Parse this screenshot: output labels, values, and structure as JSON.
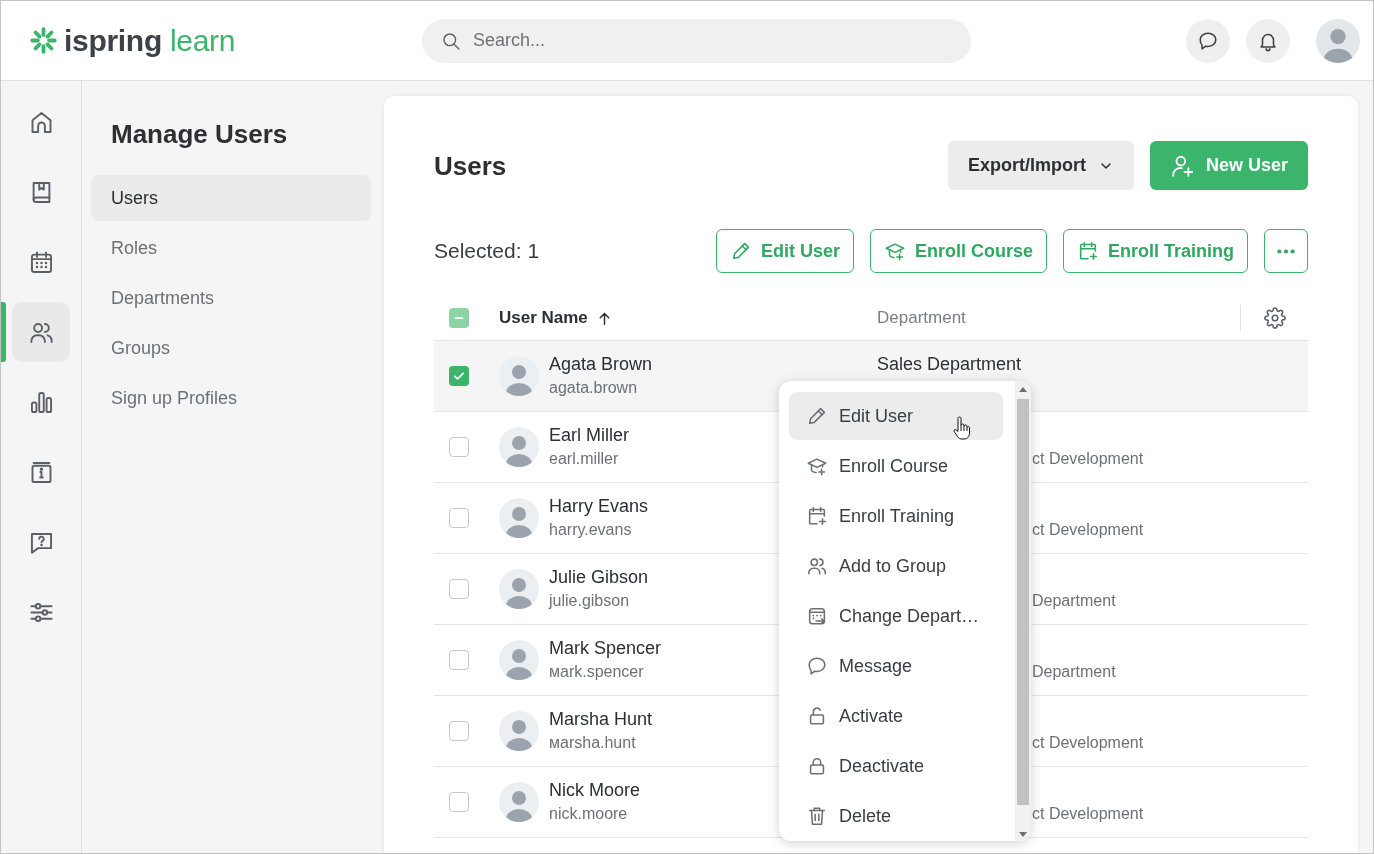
{
  "header": {
    "logo": {
      "brand": "ispring",
      "product": "learn"
    },
    "search": {
      "placeholder": "Search..."
    }
  },
  "rail": {
    "items": [
      {
        "selected": false
      },
      {
        "selected": false
      },
      {
        "selected": false
      },
      {
        "selected": true
      },
      {
        "selected": false
      },
      {
        "selected": false
      },
      {
        "selected": false
      },
      {
        "selected": false
      }
    ]
  },
  "sidebar": {
    "title": "Manage Users",
    "items": [
      {
        "label": "Users",
        "selected": true
      },
      {
        "label": "Roles",
        "selected": false
      },
      {
        "label": "Departments",
        "selected": false
      },
      {
        "label": "Groups",
        "selected": false
      },
      {
        "label": "Sign up Profiles",
        "selected": false
      }
    ]
  },
  "page": {
    "title": "Users",
    "actions": [
      {
        "kind": "dropdown",
        "label": "Export/Import"
      },
      {
        "kind": "primary",
        "label": "New User"
      }
    ]
  },
  "selection": {
    "label": "Selected: 1",
    "actions": [
      {
        "kind": "outline",
        "label": "Edit User"
      },
      {
        "kind": "outline",
        "label": "Enroll Course"
      },
      {
        "kind": "outline",
        "label": "Enroll Training"
      },
      {
        "kind": "more"
      }
    ]
  },
  "table": {
    "select_all": {
      "indeterminate": true
    },
    "columns": [
      {
        "label": "User Name",
        "sorted": true
      },
      {
        "label": "Department",
        "sorted": false
      }
    ],
    "rows": [
      {
        "checked": true,
        "name": "Agata Brown",
        "login": "agata.brown",
        "department": "Sales Department"
      },
      {
        "checked": false,
        "name": "Earl Miller",
        "login": "earl.miller",
        "department_line_2": "ct Development"
      },
      {
        "checked": false,
        "name": "Harry Evans",
        "login": "harry.evans",
        "department_line_2": "ct Development"
      },
      {
        "checked": false,
        "name": "Julie Gibson",
        "login": "julie.gibson",
        "department_line_2": "Department"
      },
      {
        "checked": false,
        "name": "Mark Spencer",
        "login": "мark.spencer",
        "department_line_2": "Department"
      },
      {
        "checked": false,
        "name": "Marsha Hunt",
        "login": "мarsha.hunt",
        "department_line_2": "ct Development"
      },
      {
        "checked": false,
        "name": "Nick Moore",
        "login": "nick.moore",
        "department_line_2": "ct Development"
      }
    ]
  },
  "context_menu": {
    "items": [
      {
        "label": "Edit User",
        "hovered": true
      },
      {
        "label": "Enroll Course",
        "hovered": false
      },
      {
        "label": "Enroll Training",
        "hovered": false
      },
      {
        "label": "Add to Group",
        "hovered": false
      },
      {
        "label": "Change Depart…",
        "hovered": false
      },
      {
        "label": "Message",
        "hovered": false
      },
      {
        "label": "Activate",
        "hovered": false
      },
      {
        "label": "Deactivate",
        "hovered": false
      },
      {
        "label": "Delete",
        "hovered": false
      }
    ]
  }
}
